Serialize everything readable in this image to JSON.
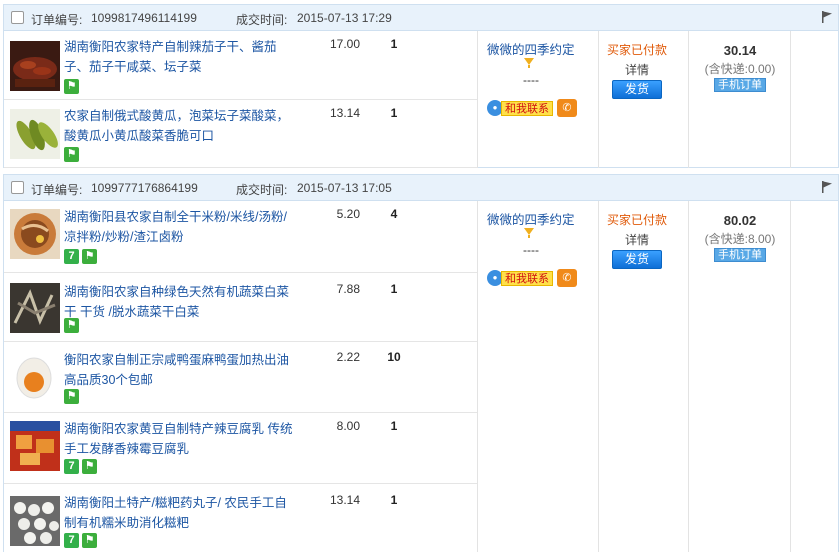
{
  "orders": [
    {
      "order_label": "订单编号:",
      "order_no": "1099817496114199",
      "time_label": "成交时间:",
      "time": "2015-07-13 17:29",
      "items": [
        {
          "title": "湖南衡阳农家特产自制辣茄子干、酱茄子、茄子干咸菜、坛子菜",
          "price": "17.00",
          "qty": "1",
          "badges": [
            "guarantee-icon"
          ]
        },
        {
          "title": "农家自制俄式酸黄瓜，泡菜坛子菜酸菜，酸黄瓜小黄瓜酸菜香脆可口",
          "price": "13.14",
          "qty": "1",
          "badges": [
            "guarantee-icon"
          ]
        }
      ],
      "buyer": "微微的四季约定",
      "buyer_sub": "----",
      "contact": "和我联系",
      "status": "买家已付款",
      "detail": "详情",
      "ship_button": "发货",
      "total": "30.14",
      "shipping": "(含快递:0.00)",
      "mobile_tag": "手机订单"
    },
    {
      "order_label": "订单编号:",
      "order_no": "1099777176864199",
      "time_label": "成交时间:",
      "time": "2015-07-13 17:05",
      "items": [
        {
          "title": "湖南衡阳县农家自制全干米粉/米线/汤粉/凉拌粉/炒粉/渣江卤粉",
          "price": "5.20",
          "qty": "4",
          "badges": [
            "seven-day-icon",
            "guarantee-icon"
          ]
        },
        {
          "title": "湖南衡阳农家自种绿色天然有机蔬菜白菜干 干货 /脱水蔬菜干白菜",
          "price": "7.88",
          "qty": "1",
          "badges": [
            "guarantee-icon"
          ]
        },
        {
          "title": "衡阳农家自制正宗咸鸭蛋麻鸭蛋加热出油高品质30个包邮",
          "price": "2.22",
          "qty": "10",
          "badges": [
            "guarantee-icon"
          ]
        },
        {
          "title": "湖南衡阳农家黄豆自制特产辣豆腐乳 传统手工发酵香辣霉豆腐乳",
          "price": "8.00",
          "qty": "1",
          "badges": [
            "seven-day-icon",
            "guarantee-icon"
          ]
        },
        {
          "title": "湖南衡阳土特产/糍粑药丸子/ 农民手工自制有机糯米助消化糍粑",
          "price": "13.14",
          "qty": "1",
          "badges": [
            "seven-day-icon",
            "guarantee-icon"
          ]
        }
      ],
      "buyer": "微微的四季约定",
      "buyer_sub": "----",
      "contact": "和我联系",
      "status": "买家已付款",
      "detail": "详情",
      "ship_button": "发货",
      "total": "80.02",
      "shipping": "(含快递:8.00)",
      "mobile_tag": "手机订单"
    }
  ]
}
